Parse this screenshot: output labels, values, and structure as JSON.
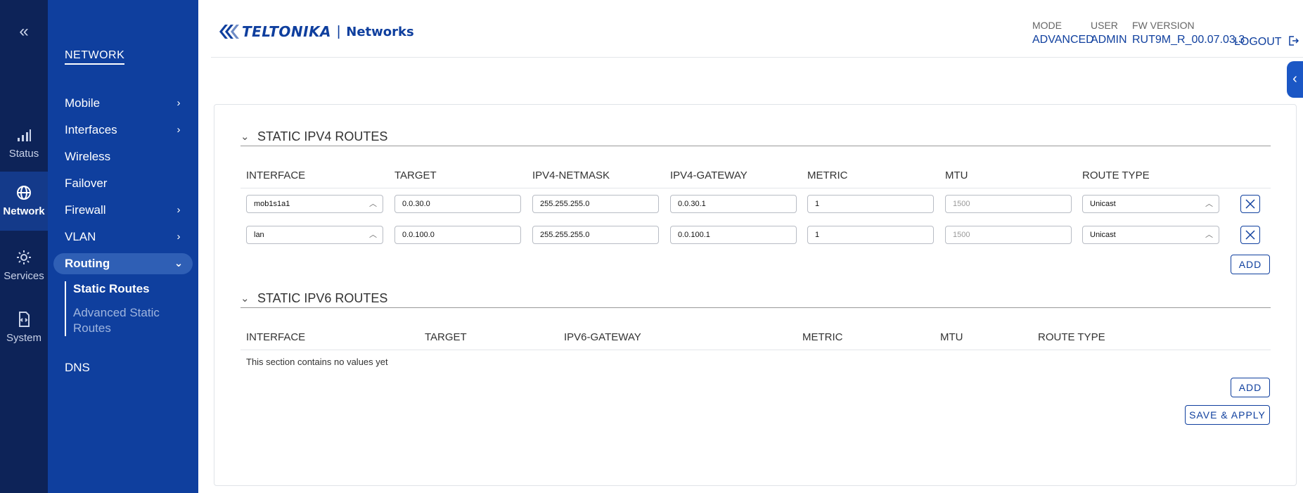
{
  "rail": {
    "collapse_symbol": "«",
    "items": [
      {
        "label": "Status",
        "icon": "signal-icon"
      },
      {
        "label": "Network",
        "icon": "globe-icon"
      },
      {
        "label": "Services",
        "icon": "gear-icon"
      },
      {
        "label": "System",
        "icon": "code-file-icon"
      }
    ]
  },
  "sidebar": {
    "title": "NETWORK",
    "items": [
      {
        "label": "Mobile",
        "chevron": "›"
      },
      {
        "label": "Interfaces",
        "chevron": "›"
      },
      {
        "label": "Wireless"
      },
      {
        "label": "Failover"
      },
      {
        "label": "Firewall",
        "chevron": "›"
      },
      {
        "label": "VLAN",
        "chevron": "›"
      },
      {
        "label": "Routing",
        "chevron": "⌄"
      },
      {
        "label": "DNS"
      }
    ],
    "sub_items": [
      "Static Routes",
      "Advanced Static Routes"
    ]
  },
  "header": {
    "logo_brand": "TELTONIKA",
    "logo_separator": "|",
    "logo_product": "Networks",
    "mode_label": "MODE",
    "mode_value": "ADVANCED",
    "user_label": "USER",
    "user_value": "ADMIN",
    "fw_label": "FW VERSION",
    "fw_value": "RUT9M_R_00.07.03.3",
    "logout_label": "LOGOUT"
  },
  "ipv4": {
    "title": "STATIC IPV4 ROUTES",
    "columns": [
      "INTERFACE",
      "TARGET",
      "IPV4-NETMASK",
      "IPV4-GATEWAY",
      "METRIC",
      "MTU",
      "ROUTE TYPE"
    ],
    "rows": [
      {
        "interface": "mob1s1a1",
        "target": "0.0.30.0",
        "netmask": "255.255.255.0",
        "gateway": "0.0.30.1",
        "metric": "1",
        "mtu_placeholder": "1500",
        "route_type": "Unicast"
      },
      {
        "interface": "lan",
        "target": "0.0.100.0",
        "netmask": "255.255.255.0",
        "gateway": "0.0.100.1",
        "metric": "1",
        "mtu_placeholder": "1500",
        "route_type": "Unicast"
      }
    ],
    "add_label": "ADD"
  },
  "ipv6": {
    "title": "STATIC IPV6 ROUTES",
    "columns": [
      "INTERFACE",
      "TARGET",
      "IPV6-GATEWAY",
      "METRIC",
      "MTU",
      "ROUTE TYPE"
    ],
    "empty_message": "This section contains no values yet",
    "add_label": "ADD"
  },
  "save_apply_label": "SAVE & APPLY",
  "colors": {
    "rail_bg": "#0d2358",
    "sidebar_bg": "#0f3f9e",
    "accent": "#0f3f9e",
    "active_pill": "#2f5fb5"
  }
}
